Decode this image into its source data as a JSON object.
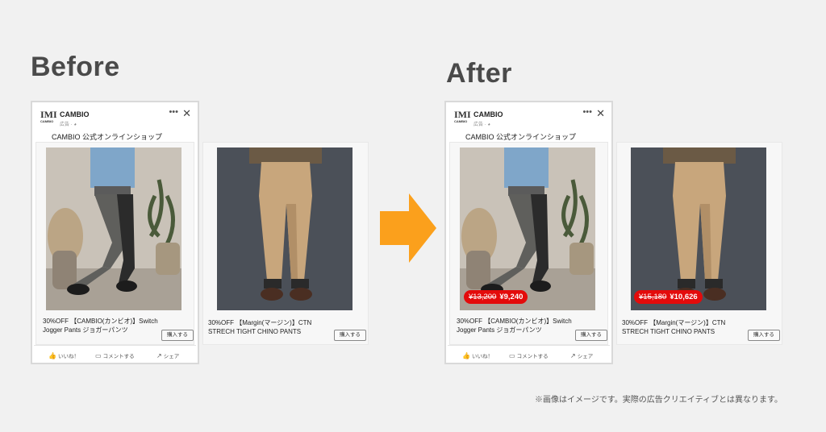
{
  "before": {
    "heading": "Before"
  },
  "after": {
    "heading": "After"
  },
  "ad": {
    "brand": "CAMBIO",
    "sponsored": "広告 ·",
    "store_name": "CAMBIO 公式オンラインショップ",
    "logo_letter": "IMI",
    "logo_sub": "CAMBIO"
  },
  "items": [
    {
      "title_line1": "30%OFF 【CAMBIO(カンビオ)】Switch",
      "title_line2": "Jogger Pants ジョガーパンツ",
      "buy_label": "購入する",
      "original_price": "¥13,200",
      "sale_price": "¥9,240"
    },
    {
      "title_line1": "30%OFF 【Margin(マージン)】CTN",
      "title_line2": "STRECH TIGHT CHINO  PANTS",
      "buy_label": "購入する",
      "original_price": "¥15,180",
      "sale_price": "¥10,626"
    }
  ],
  "reactions": {
    "like": "いいね！",
    "comment": "コメントする",
    "share": "シェア"
  },
  "icons": {
    "menu": "more-horizontal-icon",
    "close": "close-icon",
    "like": "thumbs-up-icon",
    "comment": "comment-icon",
    "share": "share-icon",
    "arrow": "arrow-right-icon"
  },
  "colors": {
    "price_badge": "#e30b0b",
    "arrow": "#fba01c",
    "heading": "#4a4a4a"
  },
  "note": "※画像はイメージです。実際の広告クリエイティブとは異なります。"
}
